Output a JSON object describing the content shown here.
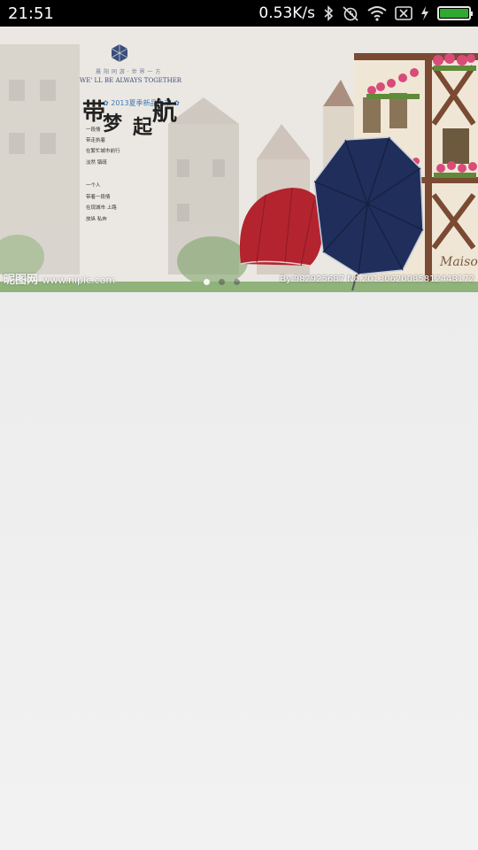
{
  "status_bar": {
    "time": "21:51",
    "net_speed": "0.53K/s",
    "icons": [
      "bluetooth-icon",
      "alarm-off-icon",
      "wifi-icon",
      "no-sim-icon",
      "charging-icon",
      "battery-icon"
    ],
    "battery_level": 1.0,
    "battery_color": "#2fa92f"
  },
  "banner": {
    "brand_tagline": "晨 阳 同 游 · 世 界 一 方",
    "brand_slogan": "WE' LL BE ALWAYS TOGETHER",
    "launch_text": "✿ 2013夏季新品上市 ✿",
    "title_chars": [
      "带",
      "梦",
      "起",
      "航"
    ],
    "poem_lines_1": [
      "一段情",
      "带走执着",
      "在繁忙城市前行",
      "淡然  镇疏"
    ],
    "poem_lines_2": [
      "一个人",
      "带着一段情",
      "在现城市 上路",
      "放纵  私奔"
    ],
    "watermark_left": "昵图网",
    "watermark_url": "www.nipic.com",
    "watermark_right": "By:982925687  No.20130620085812448172",
    "shop_sign": "Maison",
    "carousel_pages": 3,
    "carousel_active": 0
  }
}
